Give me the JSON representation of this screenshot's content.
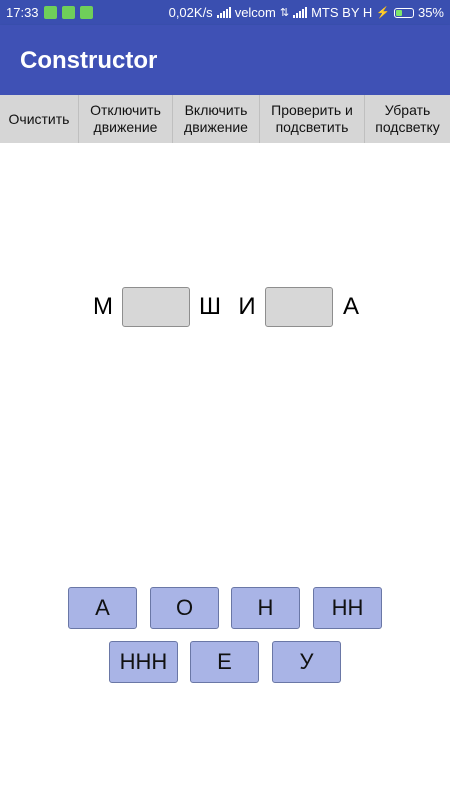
{
  "status_bar": {
    "time": "17:33",
    "network_speed": "0,02K/s",
    "carrier1": "velcom",
    "carrier2": "MTS  BY  H",
    "battery": "35%",
    "battery_level": 0.35
  },
  "app_bar": {
    "title": "Constructor"
  },
  "toolbar": {
    "buttons": [
      {
        "label": "Очистить"
      },
      {
        "label": "Отключить\nдвижение"
      },
      {
        "label": "Включить\nдвижение"
      },
      {
        "label": "Проверить и\nподсветить"
      },
      {
        "label": "Убрать\nподсветку"
      }
    ]
  },
  "word": {
    "letters": [
      "М",
      "Ш",
      "И",
      "А"
    ]
  },
  "tiles": [
    "А",
    "О",
    "Н",
    "НН",
    "ННН",
    "Е",
    "У"
  ],
  "colors": {
    "app_bar": "#3f51b5",
    "status_bar": "#3a4fb0",
    "tile": "#a9b4e6",
    "slot": "#d7d7d7",
    "toolbar": "#d6d6d6"
  }
}
